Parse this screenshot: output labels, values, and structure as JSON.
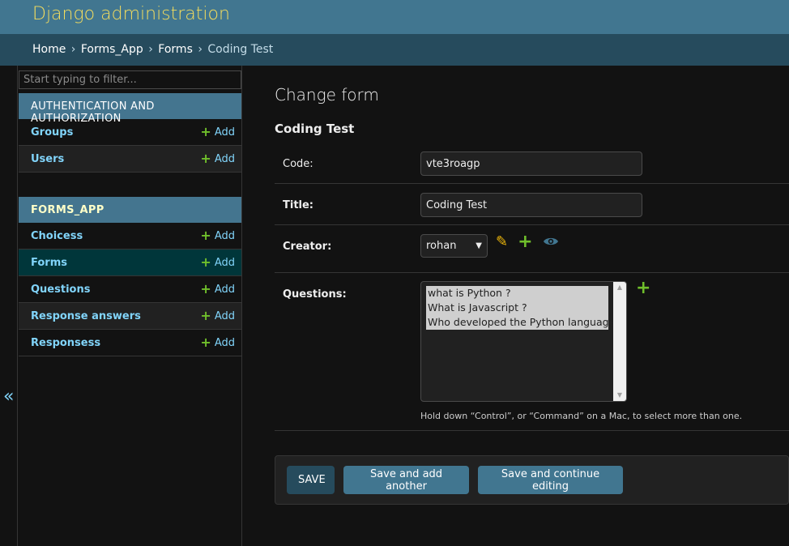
{
  "header": {
    "site_name": "Django administration"
  },
  "breadcrumbs": {
    "home": "Home",
    "app": "Forms_App",
    "model": "Forms",
    "current": "Coding Test",
    "separator": "›"
  },
  "sidebar": {
    "filter_placeholder": "Start typing to filter...",
    "toggle_glyph": "«",
    "modules": [
      {
        "caption": "AUTHENTICATION AND AUTHORIZATION",
        "items": [
          {
            "label": "Groups",
            "add": "Add"
          },
          {
            "label": "Users",
            "add": "Add"
          }
        ]
      },
      {
        "caption": "FORMS_APP",
        "items": [
          {
            "label": "Choicess",
            "add": "Add"
          },
          {
            "label": "Forms",
            "add": "Add"
          },
          {
            "label": "Questions",
            "add": "Add"
          },
          {
            "label": "Response answers",
            "add": "Add"
          },
          {
            "label": "Responsess",
            "add": "Add"
          }
        ]
      }
    ]
  },
  "content": {
    "page_title": "Change form",
    "object_title": "Coding Test",
    "fields": {
      "code": {
        "label": "Code:",
        "value": "vte3roagp"
      },
      "title": {
        "label": "Title:",
        "value": "Coding Test"
      },
      "creator": {
        "label": "Creator:",
        "value": "rohan"
      },
      "questions": {
        "label": "Questions:",
        "options": [
          "what is Python ?",
          "What is Javascript ?",
          "Who developed the Python language?"
        ],
        "help": "Hold down “Control”, or “Command” on a Mac, to select more than one."
      }
    },
    "buttons": {
      "save": "SAVE",
      "save_add": "Save and add another",
      "save_continue": "Save and continue editing"
    }
  },
  "colors": {
    "header": "#417690",
    "breadcrumbs": "#264b5d",
    "site_name": "#f5dd5d",
    "link": "#81d4fa",
    "add_green": "#70bf2b",
    "pencil": "#efb80b",
    "background": "#121212"
  }
}
